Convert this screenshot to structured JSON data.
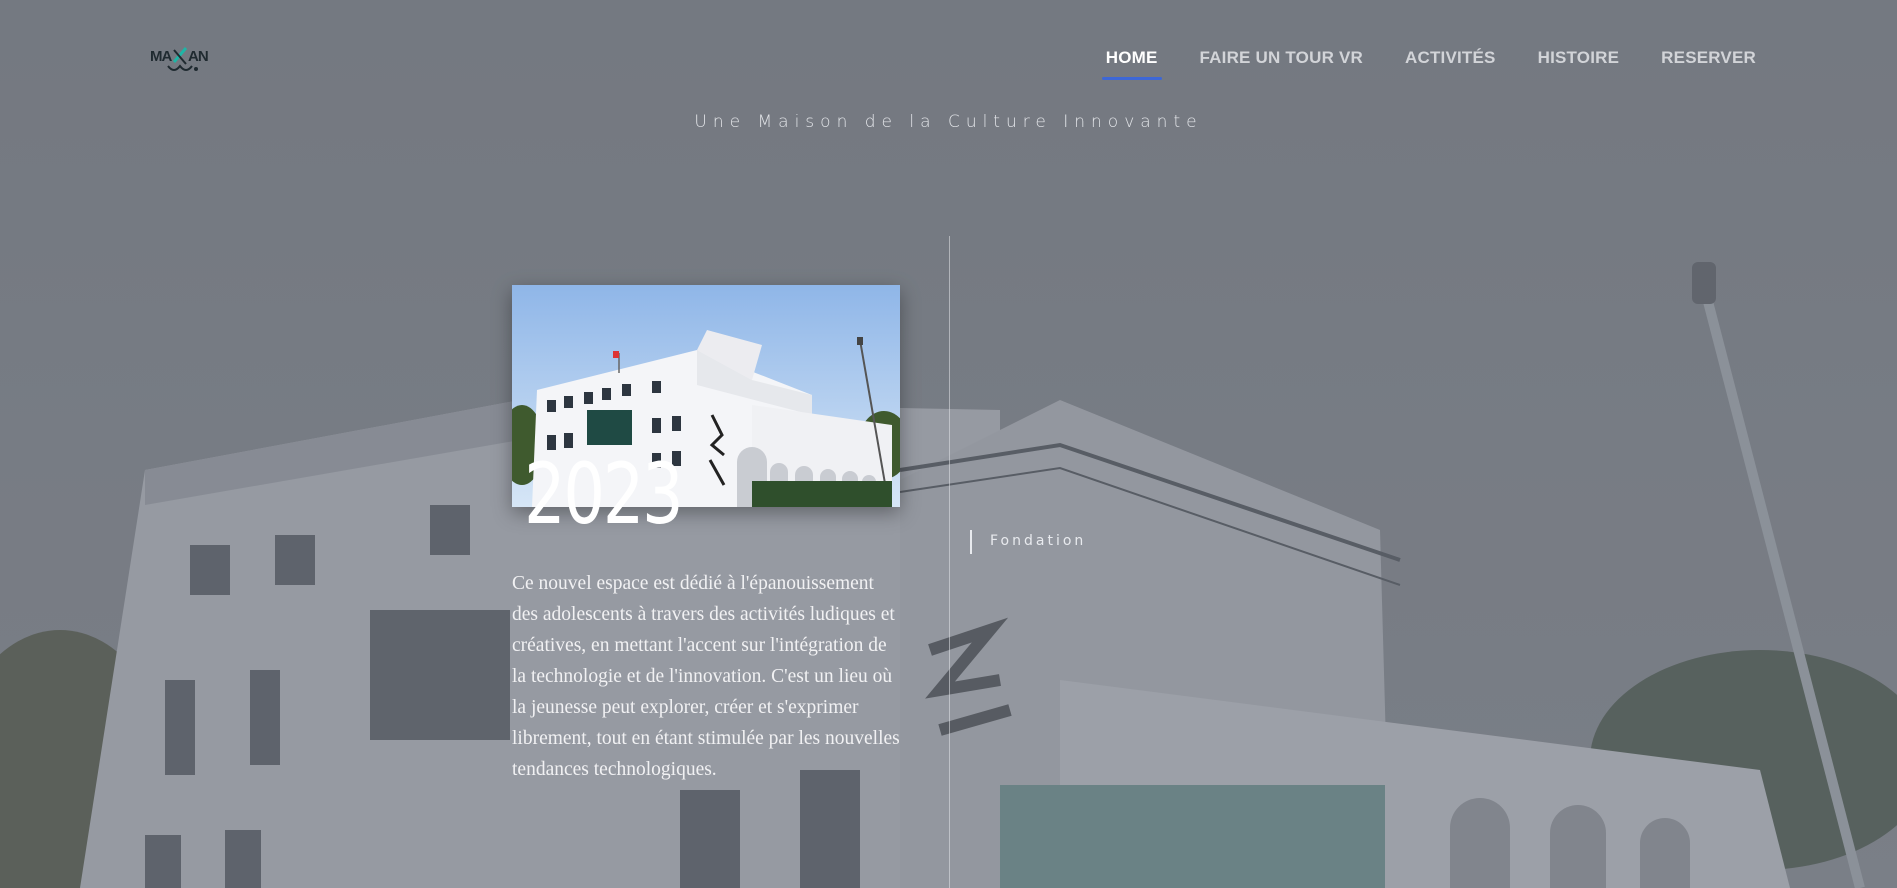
{
  "header": {
    "logo_text": "MAKAN",
    "nav": [
      {
        "label": "HOME",
        "active": true
      },
      {
        "label": "FAIRE UN TOUR VR",
        "active": false
      },
      {
        "label": "ACTIVITÉS",
        "active": false
      },
      {
        "label": "HISTOIRE",
        "active": false
      },
      {
        "label": "RESERVER",
        "active": false
      }
    ],
    "accent_color": "#3d67d6"
  },
  "tagline": "Une Maison de la Culture Innovante",
  "timeline": {
    "entry": {
      "year": "2023",
      "milestone": "Fondation",
      "description": "Ce nouvel espace est dédié à l'épanouissement des adolescents à travers des activités ludiques et créatives, en mettant l'accent sur l'intégration de la technologie et de l'innovation. C'est un lieu où la jeunesse peut explorer, créer et s'exprimer librement, tout en étant stimulée par les nouvelles tendances technologiques.",
      "image": "building-photo"
    }
  }
}
